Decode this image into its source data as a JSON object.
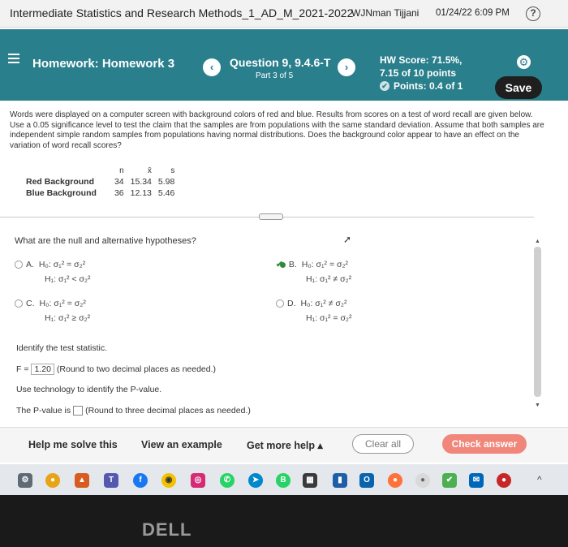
{
  "titlebar": {
    "course": "Intermediate Statistics and Research Methods_1_AD_M_2021-2022",
    "user": "WJNman Tijjani",
    "datetime": "01/24/22 6:09 PM"
  },
  "header": {
    "homework_title": "Homework: Homework 3",
    "prev_label": "‹",
    "next_label": "›",
    "question_title": "Question 9, 9.4.6-T",
    "question_part": "Part 3 of 5",
    "hw_score": "HW Score: 71.5%,",
    "score_points": "7.15 of 10 points",
    "points": "Points: 0.4 of 1",
    "save_label": "Save"
  },
  "problem": {
    "text": "Words were displayed on a computer screen with background colors of red and blue. Results from scores on a test of word recall are given below. Use a 0.05 significance level to test the claim that the samples are from populations with the same standard deviation. Assume that both samples are independent simple random samples from populations having normal distributions. Does the background color appear to have an effect on the variation of word recall scores?",
    "table": {
      "headers": [
        "n",
        "x̄",
        "s"
      ],
      "rows": [
        {
          "label": "Red Background",
          "n": "34",
          "mean": "15.34",
          "s": "5.98"
        },
        {
          "label": "Blue Background",
          "n": "36",
          "mean": "12.13",
          "s": "5.46"
        }
      ]
    }
  },
  "question": {
    "prompt": "What are the null and alternative hypotheses?",
    "options": [
      {
        "letter": "A.",
        "h0": "H₀: σ₁² = σ₂²",
        "h1": "H₁: σ₁² < σ₂²",
        "selected": false
      },
      {
        "letter": "B.",
        "h0": "H₀: σ₁² = σ₂²",
        "h1": "H₁: σ₁² ≠ σ₂²",
        "selected": true
      },
      {
        "letter": "C.",
        "h0": "H₀: σ₁² = σ₂²",
        "h1": "H₁: σ₁² ≥ σ₂²",
        "selected": false
      },
      {
        "letter": "D.",
        "h0": "H₀: σ₁² ≠ σ₂²",
        "h1": "H₁: σ₁² = σ₂²",
        "selected": false
      }
    ],
    "identify_stat": "Identify the test statistic.",
    "f_label": "F =",
    "f_value": "1.20",
    "f_note": "(Round to two decimal places as needed.)",
    "use_tech": "Use technology to identify the P-value.",
    "pvalue_label": "The P-value is",
    "pvalue_note": "(Round to three decimal places as needed.)"
  },
  "footer": {
    "help_solve": "Help me solve this",
    "view_example": "View an example",
    "get_more_help": "Get more help ▴",
    "clear_all": "Clear all",
    "check_answer": "Check answer"
  },
  "taskbar": {
    "icons": [
      "settings-icon",
      "chrome-icon",
      "warning-icon",
      "teams-icon",
      "facebook-icon",
      "camera-icon",
      "instagram-icon",
      "whatsapp-icon",
      "telegram-icon",
      "whatsapp-business-icon",
      "app-icon",
      "outlook-icon",
      "firefox-icon",
      "chrome-icon",
      "check-app-icon",
      "mail-icon",
      "record-icon"
    ]
  },
  "bezel": {
    "brand": "DELL"
  }
}
